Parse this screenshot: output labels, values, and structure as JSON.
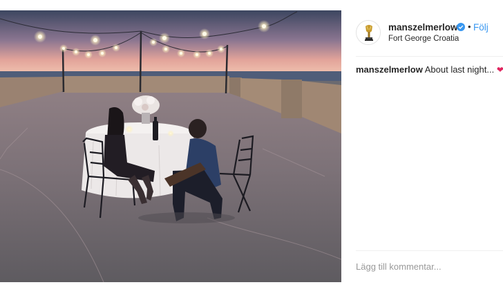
{
  "post": {
    "username": "manszelmerlow",
    "verified_icon": "verified-badge-icon",
    "separator": "•",
    "follow_label": "Följ",
    "location": "Fort George Croatia",
    "caption_user": "manszelmerlow",
    "caption_text": "About last night...",
    "caption_emoji": "❤",
    "comment_placeholder": "Lägg till kommentar..."
  },
  "colors": {
    "link": "#3897f0",
    "text": "#262626",
    "placeholder": "#999999"
  }
}
